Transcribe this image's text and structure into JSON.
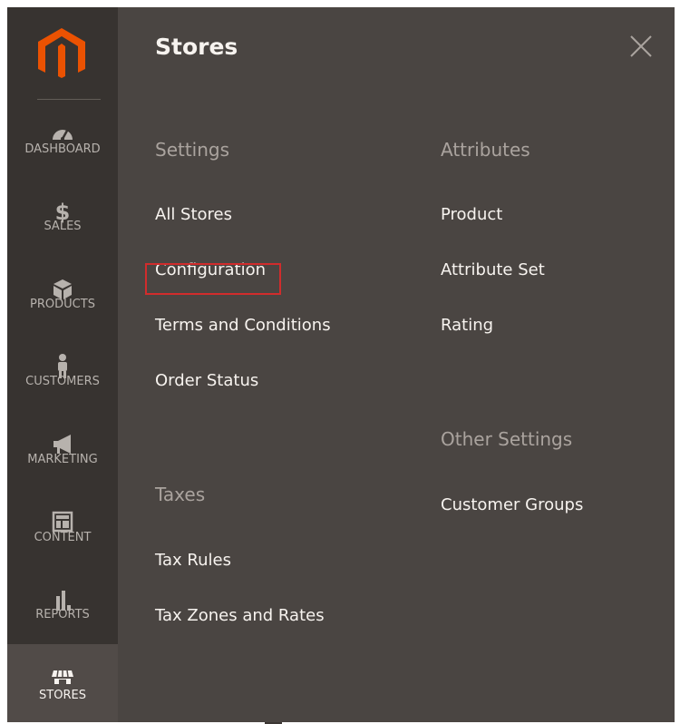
{
  "brand": {
    "logo": "magento-logo-icon"
  },
  "sidebar": {
    "items": [
      {
        "label": "DASHBOARD",
        "icon": "dashboard-icon",
        "active": false
      },
      {
        "label": "SALES",
        "icon": "dollar-icon",
        "active": false
      },
      {
        "label": "PRODUCTS",
        "icon": "cube-icon",
        "active": false
      },
      {
        "label": "CUSTOMERS",
        "icon": "person-icon",
        "active": false
      },
      {
        "label": "MARKETING",
        "icon": "megaphone-icon",
        "active": false
      },
      {
        "label": "CONTENT",
        "icon": "layout-icon",
        "active": false
      },
      {
        "label": "REPORTS",
        "icon": "bar-chart-icon",
        "active": false
      },
      {
        "label": "STORES",
        "icon": "store-icon",
        "active": true
      }
    ]
  },
  "panel": {
    "title": "Stores",
    "close_icon": "close-icon",
    "settings": {
      "title": "Settings",
      "links": [
        "All Stores",
        "Configuration",
        "Terms and Conditions",
        "Order Status"
      ]
    },
    "taxes": {
      "title": "Taxes",
      "links": [
        "Tax Rules",
        "Tax Zones and Rates"
      ]
    },
    "attributes": {
      "title": "Attributes",
      "links": [
        "Product",
        "Attribute Set",
        "Rating"
      ]
    },
    "other_settings": {
      "title": "Other Settings",
      "links": [
        "Customer Groups"
      ]
    }
  },
  "colors": {
    "sidebar_bg": "#373330",
    "panel_bg": "#4a4542",
    "active_bg": "#514b48",
    "accent": "#eb5202",
    "highlight_border": "#d12c2c"
  }
}
